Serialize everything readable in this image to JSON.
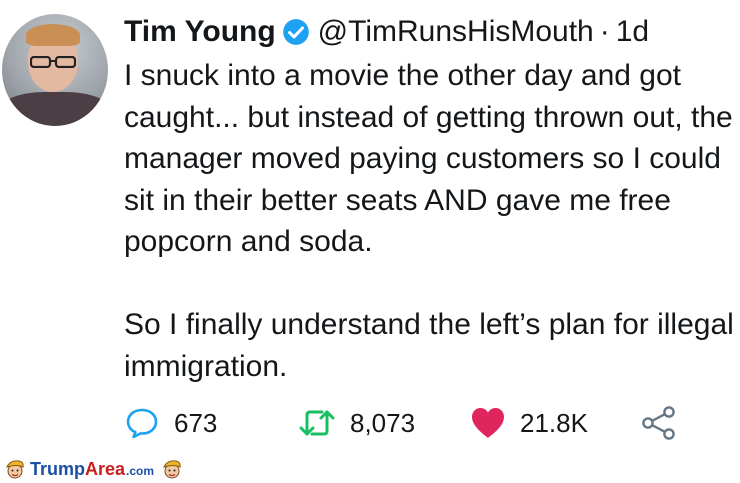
{
  "tweet": {
    "author_name": "Tim Young",
    "handle": "@TimRunsHisMouth",
    "separator": "·",
    "time": "1d",
    "paragraphs": [
      "I snuck into a movie the other day and got caught... but instead of getting thrown out, the manager moved paying customers so I could sit in their better seats AND gave me free popcorn and soda.",
      "So I finally understand the left’s plan for illegal immigration."
    ]
  },
  "actions": {
    "replies": "673",
    "retweets": "8,073",
    "likes": "21.8K"
  },
  "icons": {
    "verified": "verified-badge-icon",
    "reply": "reply-icon",
    "retweet": "retweet-icon",
    "like": "heart-icon",
    "share": "share-icon"
  },
  "colors": {
    "verified": "#1da1f2",
    "reply": "#1da1f2",
    "retweet": "#17bf63",
    "like": "#e0245e",
    "share": "#657786"
  },
  "watermark": {
    "brand_part1": "Trump",
    "brand_part2": "Area",
    "tld": ".com"
  }
}
